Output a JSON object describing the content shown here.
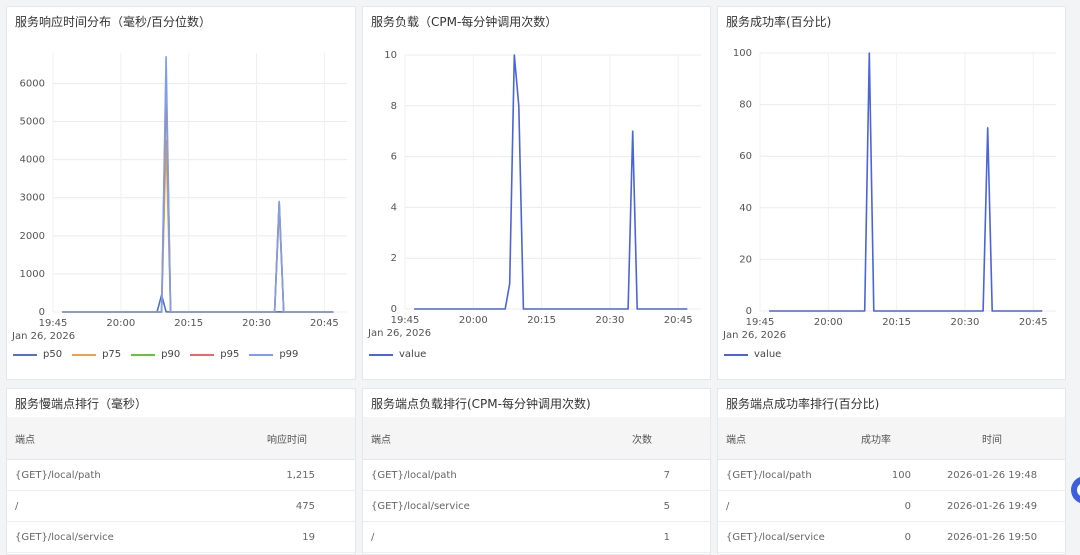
{
  "panels": {
    "p1": {
      "title": "服务响应时间分布（毫秒/百分位数）"
    },
    "p2": {
      "title": "服务负载（CPM-每分钟调用次数）"
    },
    "p3": {
      "title": "服务成功率(百分比)"
    },
    "p4": {
      "title": "服务慢端点排行（毫秒）"
    },
    "p5": {
      "title": "服务端点负载排行(CPM-每分钟调用次数)"
    },
    "p6": {
      "title": "服务端点成功率排行(百分比)"
    }
  },
  "time_axis": {
    "ticks": [
      "19:45",
      "20:00",
      "20:15",
      "20:30",
      "20:45"
    ],
    "date": "Jan 26, 2026"
  },
  "chart_data": [
    {
      "type": "line",
      "title": "服务响应时间分布（毫秒/百分位数）",
      "x": [
        "19:47",
        "19:48",
        "19:49",
        "19:50",
        "19:51",
        "19:52",
        "19:53",
        "19:54",
        "19:55",
        "19:56",
        "19:57",
        "19:58",
        "19:59",
        "20:00",
        "20:01",
        "20:02",
        "20:03",
        "20:04",
        "20:05",
        "20:06",
        "20:07",
        "20:08",
        "20:09",
        "20:10",
        "20:11",
        "20:12",
        "20:13",
        "20:14",
        "20:15",
        "20:16",
        "20:17",
        "20:18",
        "20:19",
        "20:20",
        "20:21",
        "20:22",
        "20:23",
        "20:24",
        "20:25",
        "20:26",
        "20:27",
        "20:28",
        "20:29",
        "20:30",
        "20:31",
        "20:32",
        "20:33",
        "20:34",
        "20:35",
        "20:36",
        "20:37",
        "20:38",
        "20:39",
        "20:40",
        "20:41",
        "20:42",
        "20:43",
        "20:44",
        "20:45",
        "20:46",
        "20:47"
      ],
      "ylim": [
        0,
        6800
      ],
      "yticks": [
        0,
        1000,
        2000,
        3000,
        4000,
        5000,
        6000
      ],
      "series": [
        {
          "name": "p50",
          "color": "#5470c6",
          "values": [
            0,
            0,
            0,
            0,
            0,
            0,
            0,
            0,
            0,
            0,
            0,
            0,
            0,
            0,
            0,
            0,
            0,
            0,
            0,
            0,
            0,
            0,
            450,
            5,
            0,
            0,
            0,
            0,
            0,
            0,
            0,
            0,
            0,
            0,
            0,
            0,
            0,
            0,
            0,
            0,
            0,
            0,
            0,
            0,
            0,
            0,
            0,
            0,
            5,
            0,
            0,
            0,
            0,
            0,
            0,
            0,
            0,
            0,
            0,
            0,
            0
          ]
        },
        {
          "name": "p75",
          "color": "#f0a04b",
          "values": [
            0,
            0,
            0,
            0,
            0,
            0,
            0,
            0,
            0,
            0,
            0,
            0,
            0,
            0,
            0,
            0,
            0,
            0,
            0,
            0,
            0,
            0,
            0,
            4500,
            0,
            0,
            0,
            0,
            0,
            0,
            0,
            0,
            0,
            0,
            0,
            0,
            0,
            0,
            0,
            0,
            0,
            0,
            0,
            0,
            0,
            0,
            0,
            0,
            2700,
            0,
            0,
            0,
            0,
            0,
            0,
            0,
            0,
            0,
            0,
            0,
            0
          ]
        },
        {
          "name": "p90",
          "color": "#67c23a",
          "values": [
            0,
            0,
            0,
            0,
            0,
            0,
            0,
            0,
            0,
            0,
            0,
            0,
            0,
            0,
            0,
            0,
            0,
            0,
            0,
            0,
            0,
            0,
            0,
            5900,
            0,
            0,
            0,
            0,
            0,
            0,
            0,
            0,
            0,
            0,
            0,
            0,
            0,
            0,
            0,
            0,
            0,
            0,
            0,
            0,
            0,
            0,
            0,
            0,
            2850,
            0,
            0,
            0,
            0,
            0,
            0,
            0,
            0,
            0,
            0,
            0,
            0
          ]
        },
        {
          "name": "p95",
          "color": "#ee6666",
          "values": [
            0,
            0,
            0,
            0,
            0,
            0,
            0,
            0,
            0,
            0,
            0,
            0,
            0,
            0,
            0,
            0,
            0,
            0,
            0,
            0,
            0,
            0,
            0,
            6200,
            0,
            0,
            0,
            0,
            0,
            0,
            0,
            0,
            0,
            0,
            0,
            0,
            0,
            0,
            0,
            0,
            0,
            0,
            0,
            0,
            0,
            0,
            0,
            0,
            2900,
            0,
            0,
            0,
            0,
            0,
            0,
            0,
            0,
            0,
            0,
            0,
            0
          ]
        },
        {
          "name": "p99",
          "color": "#7b9ef0",
          "values": [
            0,
            0,
            0,
            0,
            0,
            0,
            0,
            0,
            0,
            0,
            0,
            0,
            0,
            0,
            0,
            0,
            0,
            0,
            0,
            0,
            0,
            0,
            0,
            6700,
            0,
            0,
            0,
            0,
            0,
            0,
            0,
            0,
            0,
            0,
            0,
            0,
            0,
            0,
            0,
            0,
            0,
            0,
            0,
            0,
            0,
            0,
            0,
            0,
            2900,
            0,
            0,
            0,
            0,
            0,
            0,
            0,
            0,
            0,
            0,
            0,
            0
          ]
        }
      ]
    },
    {
      "type": "line",
      "title": "服务负载（CPM-每分钟调用次数）",
      "x": [
        "19:47",
        "19:48",
        "19:49",
        "19:50",
        "19:51",
        "19:52",
        "19:53",
        "19:54",
        "19:55",
        "19:56",
        "19:57",
        "19:58",
        "19:59",
        "20:00",
        "20:01",
        "20:02",
        "20:03",
        "20:04",
        "20:05",
        "20:06",
        "20:07",
        "20:08",
        "20:09",
        "20:10",
        "20:11",
        "20:12",
        "20:13",
        "20:14",
        "20:15",
        "20:16",
        "20:17",
        "20:18",
        "20:19",
        "20:20",
        "20:21",
        "20:22",
        "20:23",
        "20:24",
        "20:25",
        "20:26",
        "20:27",
        "20:28",
        "20:29",
        "20:30",
        "20:31",
        "20:32",
        "20:33",
        "20:34",
        "20:35",
        "20:36",
        "20:37",
        "20:38",
        "20:39",
        "20:40",
        "20:41",
        "20:42",
        "20:43",
        "20:44",
        "20:45",
        "20:46",
        "20:47"
      ],
      "ylim": [
        0,
        10
      ],
      "yticks": [
        0,
        2,
        4,
        6,
        8,
        10
      ],
      "series": [
        {
          "name": "value",
          "color": "#4a64d9",
          "values": [
            0,
            0,
            0,
            0,
            0,
            0,
            0,
            0,
            0,
            0,
            0,
            0,
            0,
            0,
            0,
            0,
            0,
            0,
            0,
            0,
            0,
            1,
            10,
            8,
            0,
            0,
            0,
            0,
            0,
            0,
            0,
            0,
            0,
            0,
            0,
            0,
            0,
            0,
            0,
            0,
            0,
            0,
            0,
            0,
            0,
            0,
            0,
            0,
            7,
            0,
            0,
            0,
            0,
            0,
            0,
            0,
            0,
            0,
            0,
            0,
            0
          ]
        }
      ]
    },
    {
      "type": "line",
      "title": "服务成功率(百分比)",
      "x": [
        "19:47",
        "19:48",
        "19:49",
        "19:50",
        "19:51",
        "19:52",
        "19:53",
        "19:54",
        "19:55",
        "19:56",
        "19:57",
        "19:58",
        "19:59",
        "20:00",
        "20:01",
        "20:02",
        "20:03",
        "20:04",
        "20:05",
        "20:06",
        "20:07",
        "20:08",
        "20:09",
        "20:10",
        "20:11",
        "20:12",
        "20:13",
        "20:14",
        "20:15",
        "20:16",
        "20:17",
        "20:18",
        "20:19",
        "20:20",
        "20:21",
        "20:22",
        "20:23",
        "20:24",
        "20:25",
        "20:26",
        "20:27",
        "20:28",
        "20:29",
        "20:30",
        "20:31",
        "20:32",
        "20:33",
        "20:34",
        "20:35",
        "20:36",
        "20:37",
        "20:38",
        "20:39",
        "20:40",
        "20:41",
        "20:42",
        "20:43",
        "20:44",
        "20:45",
        "20:46",
        "20:47"
      ],
      "ylim": [
        0,
        100
      ],
      "yticks": [
        0,
        20,
        40,
        60,
        80,
        100
      ],
      "series": [
        {
          "name": "value",
          "color": "#4a64d9",
          "values": [
            0,
            0,
            0,
            0,
            0,
            0,
            0,
            0,
            0,
            0,
            0,
            0,
            0,
            0,
            0,
            0,
            0,
            0,
            0,
            0,
            0,
            0,
            100,
            0,
            0,
            0,
            0,
            0,
            0,
            0,
            0,
            0,
            0,
            0,
            0,
            0,
            0,
            0,
            0,
            0,
            0,
            0,
            0,
            0,
            0,
            0,
            0,
            0,
            71,
            0,
            0,
            0,
            0,
            0,
            0,
            0,
            0,
            0,
            0,
            0,
            0
          ]
        }
      ]
    }
  ],
  "slow_endpoints": {
    "columns": [
      "端点",
      "响应时间"
    ],
    "rows": [
      [
        "{GET}/local/path",
        "1,215"
      ],
      [
        "/",
        "475"
      ],
      [
        "{GET}/local/service",
        "19"
      ]
    ]
  },
  "load_endpoints": {
    "columns": [
      "端点",
      "次数"
    ],
    "rows": [
      [
        "{GET}/local/path",
        "7"
      ],
      [
        "{GET}/local/service",
        "5"
      ],
      [
        "/",
        "1"
      ]
    ]
  },
  "success_endpoints": {
    "columns": [
      "端点",
      "成功率",
      "时间"
    ],
    "rows": [
      [
        "{GET}/local/path",
        "100",
        "2026-01-26 19:48"
      ],
      [
        "/",
        "0",
        "2026-01-26 19:49"
      ],
      [
        "{GET}/local/service",
        "0",
        "2026-01-26 19:50"
      ]
    ]
  }
}
